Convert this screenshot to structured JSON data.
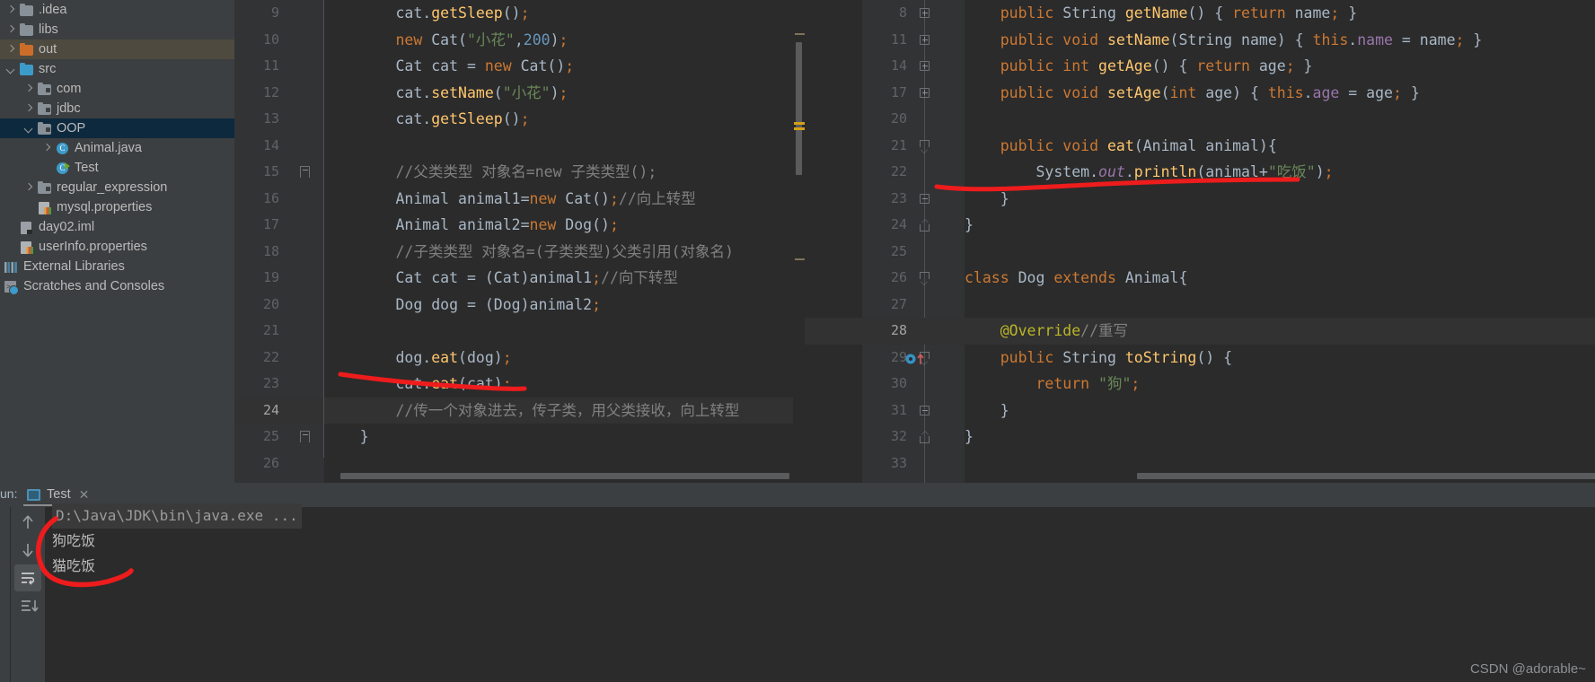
{
  "sidebar": {
    "items": [
      {
        "label": ".idea",
        "arrow": "right",
        "icon": "folder-grey",
        "indent": 0,
        "state": "none"
      },
      {
        "label": "libs",
        "arrow": "right",
        "icon": "folder-grey",
        "indent": 0,
        "state": "none"
      },
      {
        "label": "out",
        "arrow": "right",
        "icon": "folder-orange",
        "indent": 0,
        "state": "sel-inactive"
      },
      {
        "label": "src",
        "arrow": "down",
        "icon": "folder-blue",
        "indent": 0,
        "state": "none"
      },
      {
        "label": "com",
        "arrow": "right",
        "icon": "folder-package",
        "indent": 1,
        "state": "none"
      },
      {
        "label": "jdbc",
        "arrow": "right",
        "icon": "folder-package",
        "indent": 1,
        "state": "none"
      },
      {
        "label": "OOP",
        "arrow": "down",
        "icon": "folder-package",
        "indent": 1,
        "state": "sel-active"
      },
      {
        "label": "Animal.java",
        "arrow": "right",
        "icon": "java-class",
        "indent": 2,
        "state": "none"
      },
      {
        "label": "Test",
        "arrow": "none",
        "icon": "java-class-runnable",
        "indent": 2,
        "state": "none"
      },
      {
        "label": "regular_expression",
        "arrow": "right",
        "icon": "folder-package",
        "indent": 1,
        "state": "none"
      },
      {
        "label": "mysql.properties",
        "arrow": "none",
        "icon": "properties-file",
        "indent": 1,
        "state": "none"
      },
      {
        "label": "day02.iml",
        "arrow": "none",
        "icon": "iml-file",
        "indent": 0,
        "state": "none"
      },
      {
        "label": "userInfo.properties",
        "arrow": "none",
        "icon": "properties-file",
        "indent": 0,
        "state": "none"
      },
      {
        "label": "External Libraries",
        "arrow": "none",
        "icon": "libraries",
        "indent": -1,
        "state": "none"
      },
      {
        "label": "Scratches and Consoles",
        "arrow": "none",
        "icon": "scratches",
        "indent": -1,
        "state": "none"
      }
    ]
  },
  "editor": {
    "left_pane": {
      "lines": [
        {
          "n": "9",
          "fold": "none",
          "current": false
        },
        {
          "n": "10",
          "fold": "none",
          "current": false
        },
        {
          "n": "11",
          "fold": "none",
          "current": false
        },
        {
          "n": "12",
          "fold": "none",
          "current": false
        },
        {
          "n": "13",
          "fold": "none",
          "current": false
        },
        {
          "n": "14",
          "fold": "none",
          "current": false
        },
        {
          "n": "15",
          "fold": "open-top",
          "current": false
        },
        {
          "n": "16",
          "fold": "none",
          "current": false
        },
        {
          "n": "17",
          "fold": "none",
          "current": false
        },
        {
          "n": "18",
          "fold": "none",
          "current": false
        },
        {
          "n": "19",
          "fold": "none",
          "current": false
        },
        {
          "n": "20",
          "fold": "none",
          "current": false
        },
        {
          "n": "21",
          "fold": "none",
          "current": false
        },
        {
          "n": "22",
          "fold": "none",
          "current": false
        },
        {
          "n": "23",
          "fold": "none",
          "current": false
        },
        {
          "n": "24",
          "fold": "none",
          "current": true
        },
        {
          "n": "25",
          "fold": "open-top",
          "current": false
        },
        {
          "n": "26",
          "fold": "none",
          "current": false
        }
      ],
      "code_text": [
        "        cat.getSleep();",
        "        new Cat(\"小花\",200);",
        "        Cat cat = new Cat();",
        "        cat.setName(\"小花\");",
        "        cat.getSleep();",
        "",
        "        //父类类型 对象名=new 子类类型();",
        "        Animal animal1=new Cat();//向上转型",
        "        Animal animal2=new Dog();",
        "        //子类类型 对象名=(子类类型)父类引用(对象名)",
        "        Cat cat = (Cat)animal1;//向下转型",
        "        Dog dog = (Dog)animal2;",
        "",
        "        dog.eat(dog);",
        "        cat.eat(cat);",
        "        //传一个对象进去，传子类，用父类接收，向上转型",
        "    }",
        ""
      ]
    },
    "right_pane": {
      "lines": [
        {
          "n": "8",
          "fold": "plus",
          "current": false
        },
        {
          "n": "11",
          "fold": "plus",
          "current": false
        },
        {
          "n": "14",
          "fold": "plus",
          "current": false
        },
        {
          "n": "17",
          "fold": "plus",
          "current": false
        },
        {
          "n": "20",
          "fold": "none",
          "current": false
        },
        {
          "n": "21",
          "fold": "arrowdown",
          "current": false
        },
        {
          "n": "22",
          "fold": "none",
          "current": false
        },
        {
          "n": "23",
          "fold": "minus",
          "current": false
        },
        {
          "n": "24",
          "fold": "arrowup",
          "current": false
        },
        {
          "n": "25",
          "fold": "none",
          "current": false
        },
        {
          "n": "26",
          "fold": "arrowdown",
          "current": false
        },
        {
          "n": "27",
          "fold": "none",
          "current": false
        },
        {
          "n": "28",
          "fold": "none",
          "current": true
        },
        {
          "n": "29",
          "fold": "arrowdown",
          "current": false,
          "marker": "override-marker"
        },
        {
          "n": "30",
          "fold": "none",
          "current": false
        },
        {
          "n": "31",
          "fold": "minus",
          "current": false
        },
        {
          "n": "32",
          "fold": "arrowup",
          "current": false
        },
        {
          "n": "33",
          "fold": "none",
          "current": false
        }
      ],
      "code_text": [
        "    public String getName() { return name; }",
        "    public void setName(String name) { this.name = name; }",
        "    public int getAge() { return age; }",
        "    public void setAge(int age) { this.age = age; }",
        "",
        "    public void eat(Animal animal){",
        "        System.out.println(animal+\"吃饭\");",
        "    }",
        "}",
        "",
        "class Dog extends Animal{",
        "",
        "    @Override//重写",
        "    public String toString() {",
        "        return \"狗\";",
        "    }",
        "}",
        ""
      ]
    }
  },
  "run_panel": {
    "run_label": "un:",
    "tab_name": "Test",
    "close_label": "✕",
    "console_lines": [
      {
        "text": "D:\\Java\\JDK\\bin\\java.exe ...",
        "kind": "cmd"
      },
      {
        "text": "狗吃饭",
        "kind": "out"
      },
      {
        "text": "猫吃饭",
        "kind": "out"
      }
    ],
    "toolbar_icons": [
      "arrow-up-icon",
      "arrow-down-icon",
      "soft-wrap-icon",
      "scroll-to-end-icon"
    ]
  },
  "watermark": "CSDN @adorable~",
  "colors": {
    "accent": "#cc7832",
    "annotation": "#e74c3c",
    "selection": "#0d293e",
    "editor_bg": "#2b2b2b",
    "panel_bg": "#3c3f41"
  }
}
